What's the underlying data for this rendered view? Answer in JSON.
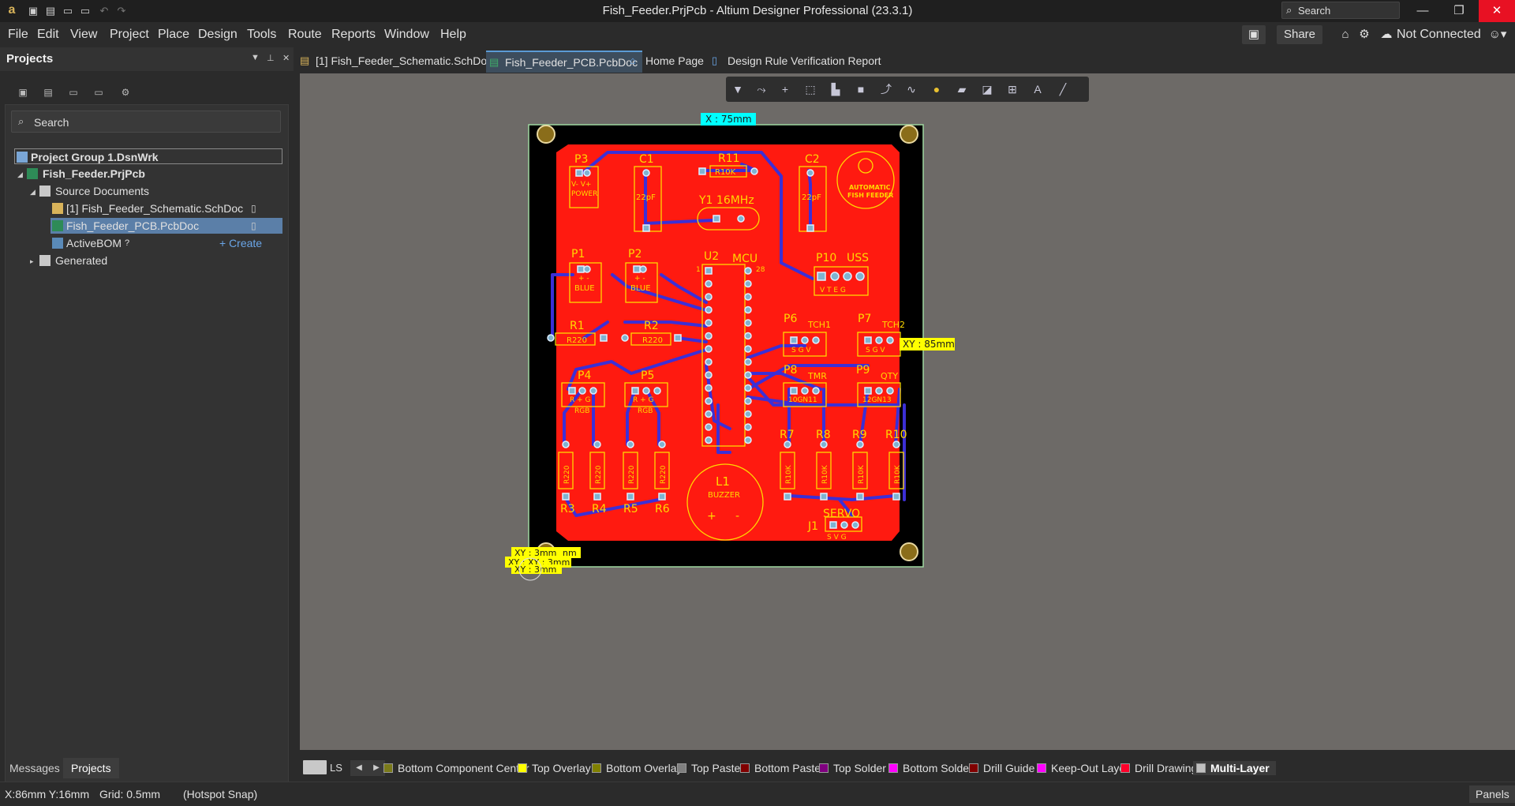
{
  "window": {
    "title": "Fish_Feeder.PrjPcb - Altium Designer Professional (23.3.1)",
    "search_label": "Search",
    "close_color": "#e81123"
  },
  "menu": {
    "items": [
      "File",
      "Edit",
      "View",
      "Project",
      "Place",
      "Design",
      "Tools",
      "Route",
      "Reports",
      "Window",
      "Help"
    ],
    "share": "Share",
    "not_connected": "Not Connected"
  },
  "projects_panel": {
    "title": "Projects",
    "search_placeholder": "Search",
    "tree": {
      "group": "Project Group 1.DsnWrk",
      "project": "Fish_Feeder.PrjPcb",
      "source_documents": "Source Documents",
      "schematic": "[1] Fish_Feeder_Schematic.SchDoc",
      "pcb": "Fish_Feeder_PCB.PcbDoc",
      "activebom": "ActiveBOM",
      "create": "+ Create",
      "generated": "Generated"
    },
    "bottom_tabs": [
      "Messages",
      "Projects"
    ]
  },
  "doc_tabs": [
    {
      "label": "[1] Fish_Feeder_Schematic.SchDoc",
      "icon": "schematic-icon"
    },
    {
      "label": "Fish_Feeder_PCB.PcbDoc",
      "icon": "pcb-icon",
      "active": true
    },
    {
      "label": "Home Page",
      "icon": "home-icon"
    },
    {
      "label": "Design Rule Verification Report",
      "icon": "report-icon"
    }
  ],
  "pcb": {
    "dim_x": "X : 75mm",
    "dim_y": "XY : 85mm",
    "dim_corner_1": "XY : 3mm",
    "dim_corner_2": "XY : XY : 3mm",
    "dim_corner_3": "XY : 3mm",
    "dim_corner_suffix": "nm",
    "logo_line1": "AUTOMATIC",
    "logo_line2": "FISH FEEDER",
    "components": {
      "P3": "P3",
      "P3_note": "V-  V+",
      "P3_power": "POWER",
      "C1": "C1",
      "C1_val": "22pF",
      "R11": "R11",
      "R11_val": "R10K",
      "C2": "C2",
      "C2_val": "22pF",
      "Y1": "Y1  16MHz",
      "U2": "U2",
      "MCU": "MCU",
      "pin1": "1",
      "pin28": "28",
      "P10": "P10",
      "USS": "USS",
      "P10_pins": "V  T  E  G",
      "P1": "P1",
      "P1_val": "BLUE",
      "pm": "+  -",
      "P2": "P2",
      "P2_val": "BLUE",
      "R1": "R1",
      "R1_val": "R220",
      "R2": "R2",
      "R2_val": "R220",
      "P6": "P6",
      "TCH1": "TCH1",
      "sgv": "S G V",
      "P7": "P7",
      "TCH2": "TCH2",
      "P4": "P4",
      "P5": "P5",
      "rpg": "R  +  G",
      "RGB": "RGB",
      "P8": "P8",
      "TMR": "TMR",
      "P8_pins": "10GN11",
      "P9": "P9",
      "QTY": "QTY",
      "P9_pins": "12GN13",
      "R7": "R7",
      "R8": "R8",
      "R9": "R9",
      "R10": "R10",
      "r10k": "R10K",
      "R3": "R3",
      "R4": "R4",
      "R5": "R5",
      "R6": "R6",
      "r220": "R220",
      "L1": "L1",
      "BUZZER": "BUZZER",
      "plus": "+",
      "minus": "-",
      "J1": "J1",
      "SERVO": "SERVO",
      "svg_pins": "S  V  G"
    }
  },
  "layers": [
    {
      "name": "Bottom Component Center",
      "color": "#7a7a1a"
    },
    {
      "name": "Top Overlay",
      "color": "#ffff00"
    },
    {
      "name": "Bottom Overlay",
      "color": "#808000"
    },
    {
      "name": "Top Paste",
      "color": "#808080"
    },
    {
      "name": "Bottom Paste",
      "color": "#800000"
    },
    {
      "name": "Top Solder",
      "color": "#800080"
    },
    {
      "name": "Bottom Solder",
      "color": "#ff00ff"
    },
    {
      "name": "Drill Guide",
      "color": "#800000"
    },
    {
      "name": "Keep-Out Layer",
      "color": "#ff00ff"
    },
    {
      "name": "Drill Drawing",
      "color": "#ff002a"
    },
    {
      "name": "Multi-Layer",
      "color": "#c0c0c0"
    }
  ],
  "layerbar_ls": "LS",
  "status": {
    "coords": "X:86mm Y:16mm",
    "grid": "Grid: 0.5mm",
    "snap": "(Hotspot Snap)",
    "panels": "Panels"
  }
}
